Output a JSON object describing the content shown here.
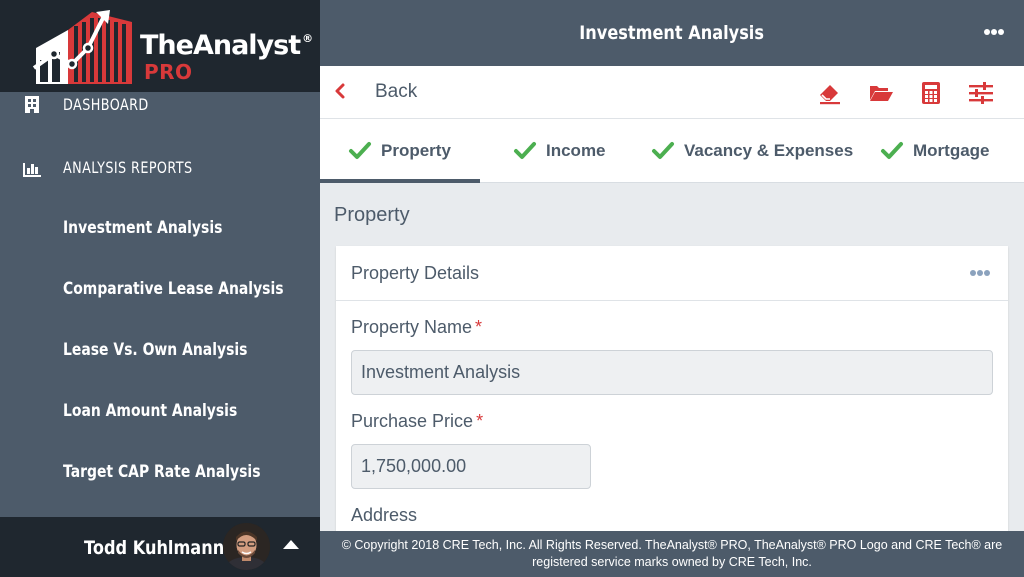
{
  "app": {
    "logo_name": "TheAnalyst",
    "logo_reg": "®",
    "logo_pro": "PRO"
  },
  "sidebar": {
    "main_items": [
      {
        "label": "DASHBOARD",
        "icon": "building-icon"
      },
      {
        "label": "ANALYSIS REPORTS",
        "icon": "bar-chart-icon"
      }
    ],
    "sub_items": [
      {
        "label": "Investment Analysis"
      },
      {
        "label": "Comparative Lease Analysis"
      },
      {
        "label": "Lease Vs. Own Analysis"
      },
      {
        "label": "Loan Amount Analysis"
      },
      {
        "label": "Target CAP Rate Analysis"
      }
    ],
    "user": {
      "name": "Todd Kuhlmann"
    }
  },
  "header": {
    "title": "Investment Analysis",
    "more_icon": "ellipsis-icon"
  },
  "toolbar": {
    "back_label": "Back",
    "tools": [
      "eraser-icon",
      "folder-open-icon",
      "calculator-icon",
      "sliders-icon"
    ]
  },
  "tabs": [
    {
      "label": "Property",
      "active": true
    },
    {
      "label": "Income",
      "active": false
    },
    {
      "label": "Vacancy & Expenses",
      "active": false
    },
    {
      "label": "Mortgage",
      "active": false
    }
  ],
  "main": {
    "section_title": "Property",
    "panel_title": "Property Details",
    "fields": [
      {
        "label": "Property Name",
        "required_mark": "*",
        "value": "Investment Analysis"
      },
      {
        "label": "Purchase Price",
        "required_mark": "*",
        "value": "1,750,000.00"
      },
      {
        "label": "Address"
      }
    ]
  },
  "footer": {
    "line1": "© Copyright 2018 CRE Tech, Inc. All Rights Reserved. TheAnalyst® PRO, TheAnalyst® PRO Logo and CRE Tech® are",
    "line2": "registered service marks owned by CRE Tech, Inc."
  },
  "colors": {
    "sidebar_bg": "#4d5b6a",
    "logo_bg": "#1f272f",
    "accent_red": "#d8393a",
    "check_green": "#4caf50",
    "text_slate": "#4d5b6a"
  }
}
